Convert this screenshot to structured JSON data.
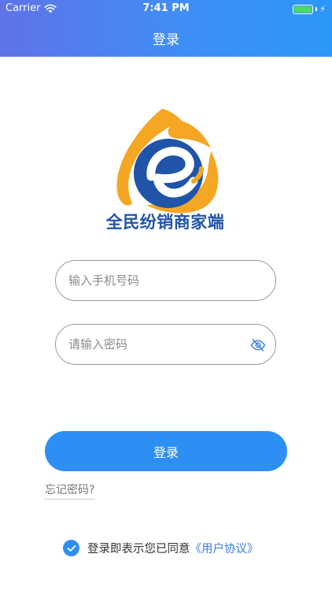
{
  "status_bar": {
    "carrier": "Carrier",
    "time": "7:41 PM",
    "battery_color": "#4cd964"
  },
  "nav": {
    "title": "登录"
  },
  "brand": {
    "logo_icon": "e-logo-icon",
    "name": "全民纷销商家端",
    "colors": {
      "orange": "#f5a623",
      "blue": "#1f54a8"
    }
  },
  "form": {
    "phone_placeholder": "输入手机号码",
    "password_placeholder": "请输入密码",
    "toggle_icon": "eye-hidden-icon"
  },
  "actions": {
    "login_label": "登录",
    "forgot_label": "忘记密码?",
    "accent_color": "#2d8ef4"
  },
  "agreement": {
    "checked": true,
    "text": "登录即表示您已同意",
    "link": "《用户协议》"
  }
}
